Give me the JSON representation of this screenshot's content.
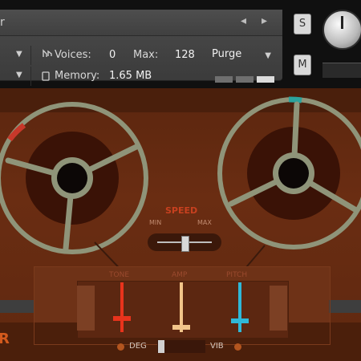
{
  "header": {
    "title_caret": "r",
    "nav_prev": "◂",
    "nav_next": "▸",
    "voices_label": "Voices:",
    "voices_value": "0",
    "max_label": "Max:",
    "max_value": "128",
    "purge_label": "Purge",
    "memory_label": "Memory:",
    "memory_value": "1.65 MB",
    "solo_label": "S",
    "mute_label": "M"
  },
  "machine": {
    "speed_label": "SPEED",
    "speed_min": "MIN",
    "speed_max": "MAX",
    "tone_label": "TONE",
    "amp_label": "AMP",
    "pitch_label": "PITCH",
    "deg_label": "DEG",
    "vib_label": "VIB",
    "corner_letter": "R",
    "speed_level": 0.5,
    "tone_level": 0.25,
    "amp_level": 0.05,
    "pitch_level": 0.2
  },
  "colors": {
    "tone": "#e8331c",
    "amp": "#f2c58a",
    "pitch": "#2fb8d8",
    "left_reel_marker": "#c8382a",
    "right_reel_marker": "#2ba39d",
    "reel": "#8f9479",
    "panel": "#5b260f"
  },
  "icons": {
    "voices": "voices-icon",
    "memory": "memory-icon",
    "tune": "tune-knob"
  }
}
